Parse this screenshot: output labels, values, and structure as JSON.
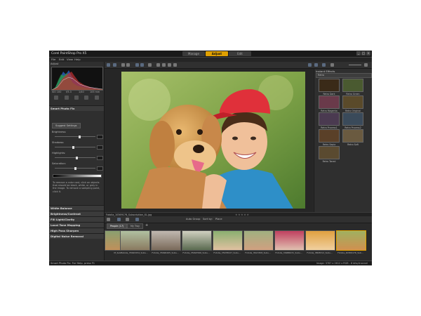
{
  "window": {
    "title": "Corel PaintShop Pro X5",
    "modes": [
      "Manage",
      "Adjust",
      "Edit"
    ],
    "active_mode": "Adjust",
    "controls": [
      "_",
      "□",
      "×"
    ]
  },
  "menu": [
    "File",
    "Edit",
    "View",
    "Help"
  ],
  "left_panel": {
    "label": "Adjust",
    "histogram_info": [
      "ISO 100",
      "f/5.3",
      "1/40",
      "105 mm"
    ],
    "smart_photo_fix": {
      "header": "Smart Photo Fix",
      "suggest_button": "Suggest Settings",
      "sliders": [
        {
          "label": "Brightness:",
          "value": 0.62
        },
        {
          "label": "Shadows:",
          "value": 0.45
        },
        {
          "label": "Highlights:",
          "value": 0.55
        },
        {
          "label": "Saturation:",
          "value": 0.5
        }
      ],
      "help_text": "To remove a color cast, click on objects that should be black, white, or grey in the image. To remove a sampling point, click it."
    },
    "sections": [
      "White Balance",
      "Brightness/Contrast",
      "Fill Light/Clarity",
      "Local Tone Mapping",
      "High Pass Sharpen",
      "Digital Noise Removal"
    ]
  },
  "right_panel": {
    "header": "Instant Effects",
    "selector": "Retro",
    "effects": [
      "Retro Dark",
      "Retro Green",
      "Retro Magenta",
      "Retro Original",
      "Retro Process1",
      "Retro Process2",
      "Retro Sepia",
      "Retro Soft",
      "Retro Toned"
    ]
  },
  "file_bar": {
    "filename": "Fotolia_10369176_Subscription_XL.jpg",
    "stars": "★★★★★"
  },
  "organizer": {
    "toolbar": [
      "Auto Group",
      "Sort by:",
      "Place"
    ],
    "tabs": [
      "People (17)",
      "My Tray"
    ],
    "thumbnails": [
      "M_Subs...",
      "Fotolia_35993254_Subs...",
      "Fotolia_35996265_Subs...",
      "Fotolia_35993566_Subs...",
      "Fotolia_35978027_Subs...",
      "Fotolia_3613308_Subs...",
      "Fotolia_39986031_Subs...",
      "Fotolia_3808312_Subs...",
      "Fotolia_40369176_Sub..."
    ]
  },
  "status": {
    "help": "Smart Photo Fix: For Help, press F1",
    "info": "Image: 3787 x 2612 x RGB - 8 bits/channel"
  },
  "colors": {
    "accent": "#e0a000",
    "background": "#2b2b2b"
  }
}
